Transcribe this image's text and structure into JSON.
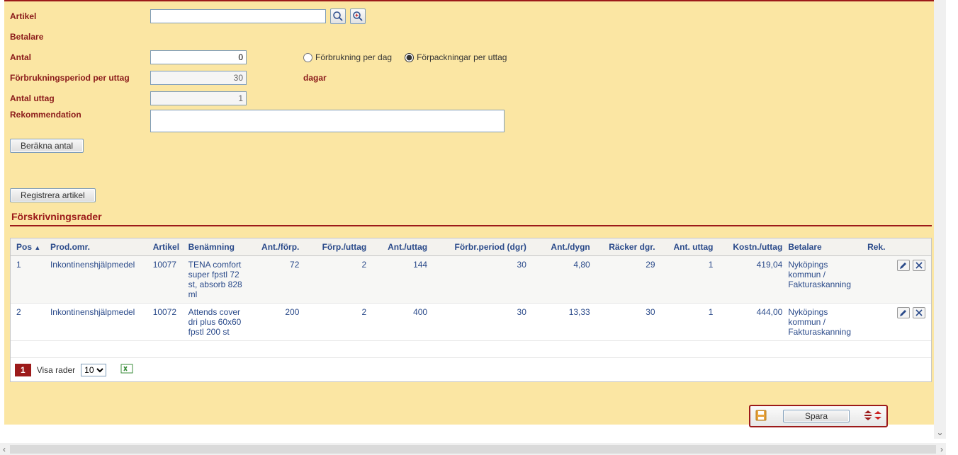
{
  "form": {
    "artikel_label": "Artikel",
    "artikel_value": "",
    "betalare_label": "Betalare",
    "antal_label": "Antal",
    "antal_value": "0",
    "forbr_per_dag": "Förbrukning per dag",
    "forp_per_uttag": "Förpackningar per uttag",
    "forbrukningsperiod_label": "Förbrukningsperiod per uttag",
    "forbrukningsperiod_value": "30",
    "dagar": "dagar",
    "antal_uttag_label": "Antal uttag",
    "antal_uttag_value": "1",
    "rekommendation_label": "Rekommendation",
    "rekommendation_value": "",
    "berakna_btn": "Beräkna antal",
    "registrera_btn": "Registrera artikel"
  },
  "grid": {
    "title": "Förskrivningsrader",
    "headers": {
      "pos": "Pos",
      "prod": "Prod.omr.",
      "art": "Artikel",
      "ben": "Benämning",
      "antforp": "Ant./förp.",
      "forput": "Förp./uttag",
      "antut": "Ant./uttag",
      "forbrp": "Förbr.period (dgr)",
      "dygn": "Ant./dygn",
      "racker": "Räcker dgr.",
      "antuttag": "Ant. uttag",
      "kost": "Kostn./uttag",
      "bet": "Betalare",
      "rek": "Rek."
    },
    "rows": [
      {
        "pos": "1",
        "prod": "Inkontinenshjälpmedel",
        "art": "10077",
        "ben": "TENA comfort super fpstl 72 st, absorb 828 ml",
        "antforp": "72",
        "forput": "2",
        "antut": "144",
        "forbrp": "30",
        "dygn": "4,80",
        "racker": "29",
        "antuttag": "1",
        "kost": "419,04",
        "bet": "Nyköpings kommun / Fakturaskanning"
      },
      {
        "pos": "2",
        "prod": "Inkontinenshjälpmedel",
        "art": "10072",
        "ben": "Attends cover dri plus 60x60 fpstl 200 st",
        "antforp": "200",
        "forput": "2",
        "antut": "400",
        "forbrp": "30",
        "dygn": "13,33",
        "racker": "30",
        "antuttag": "1",
        "kost": "444,00",
        "bet": "Nyköpings kommun / Fakturaskanning"
      }
    ],
    "pager": {
      "page": "1",
      "visa_rader_label": "Visa rader",
      "visa_rader_value": "10"
    }
  },
  "save_btn": "Spara"
}
